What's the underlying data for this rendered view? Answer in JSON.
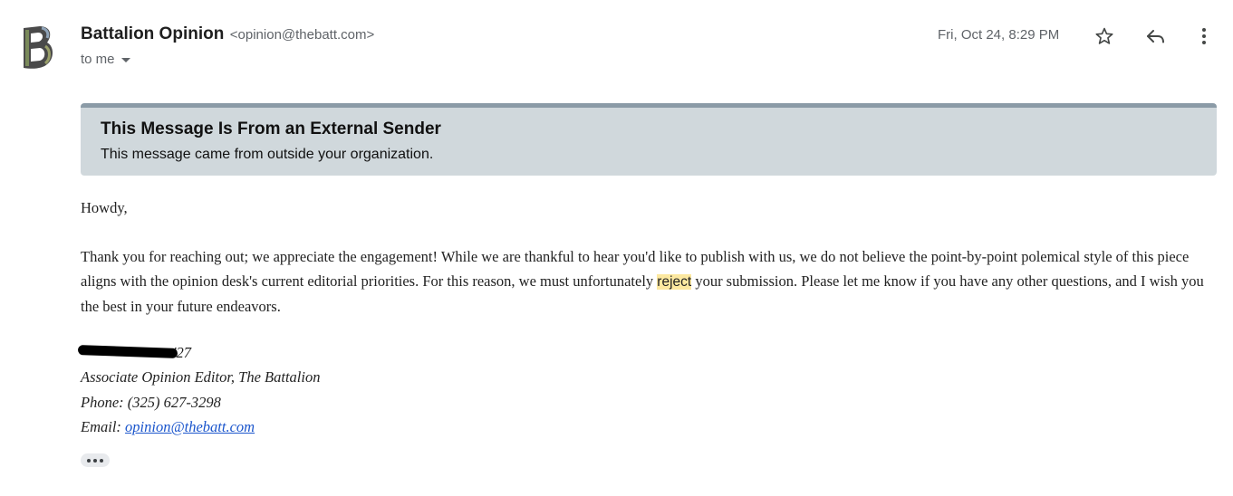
{
  "header": {
    "sender_name": "Battalion Opinion",
    "sender_email": "<opinion@thebatt.com>",
    "recipient_label": "to me",
    "date": "Fri, Oct 24, 8:29 PM",
    "icons": {
      "star": "star-icon",
      "reply": "reply-icon",
      "more": "more-vert-icon",
      "expand": "caret-down-icon"
    }
  },
  "banner": {
    "title": "This Message Is From an External Sender",
    "text": "This message came from outside your organization."
  },
  "message": {
    "greeting": "Howdy,",
    "paragraph_before": "Thank you for reaching out; we appreciate the engagement! While we are thankful to hear you'd like to publish with us, we do not believe the point-by-point polemical style of this piece aligns with the opinion desk's current editorial priorities. For this reason, we must unfortunately ",
    "highlighted_word": "reject",
    "paragraph_after": " your submission. Please let me know if you have any other questions, and I wish you the best in your future endeavors."
  },
  "signature": {
    "name_suffix": "'27",
    "title": "Associate Opinion Editor, The Battalion",
    "phone": "Phone: (325) 627-3298",
    "email_label": "Email: ",
    "email_link": "opinion@thebatt.com"
  },
  "colors": {
    "banner_bg": "#d0d8dc",
    "banner_border": "#8b9ba7",
    "highlight": "#fce8a0",
    "link": "#1a55cc"
  }
}
